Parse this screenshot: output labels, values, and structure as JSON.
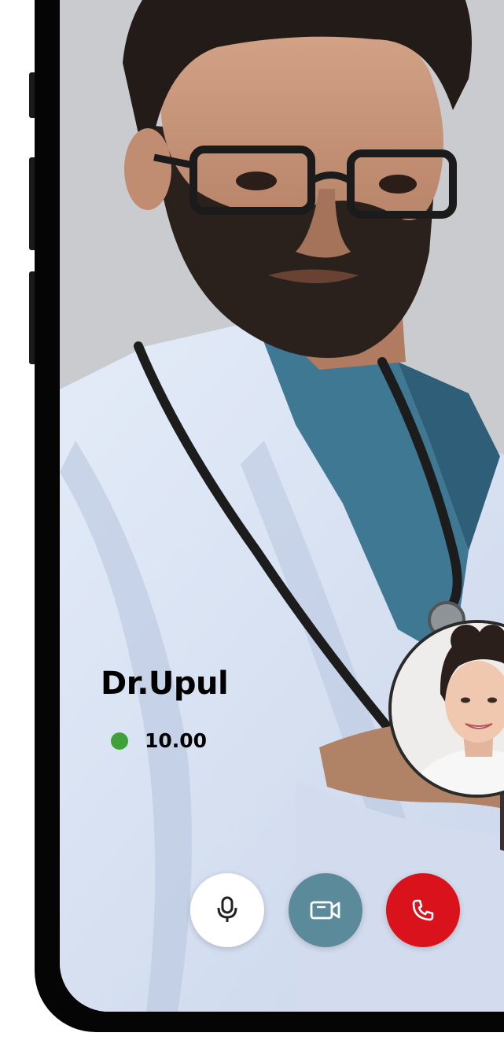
{
  "call": {
    "caller_name": "Dr.Upul",
    "call_time": "10.00",
    "status_color": "#3ea13a"
  },
  "controls": [
    {
      "name": "microphone",
      "icon": "microphone-icon",
      "color": "#ffffff"
    },
    {
      "name": "video",
      "icon": "video-camera-icon",
      "color": "#5b8a9b"
    },
    {
      "name": "end-call",
      "icon": "phone-icon",
      "color": "#d9121b"
    }
  ]
}
